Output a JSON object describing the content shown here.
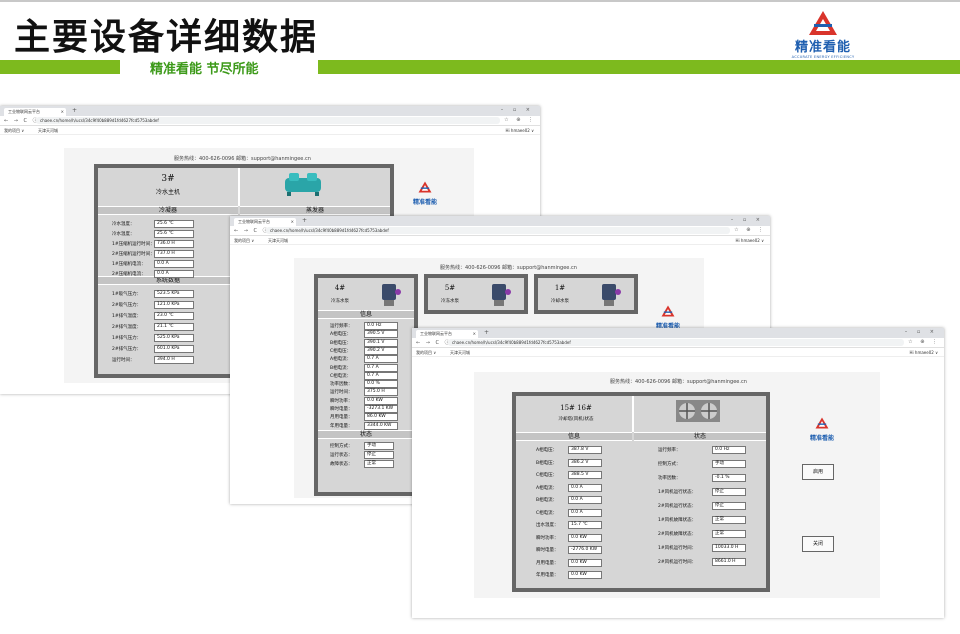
{
  "slide": {
    "title": "主要设备详细数据",
    "slogan": "精准看能 节尽所能",
    "brand_name": "精准看能",
    "brand_sub": "ACCURATE ENERGY EFFICIENCY",
    "colors": {
      "green": "#7dba1e",
      "brand_blue": "#1f5fb0",
      "brand_red": "#d9342b"
    }
  },
  "browser": {
    "tab_label": "工业物联网云平台",
    "url": "chaee.cn/home/h/ucsl/34c9f40b889d1fd4627fcd5753abdef",
    "bookmark_1": "我的项目 ∨",
    "bookmark_2": "天津天河城",
    "user": "Hi hmaee02 ∨",
    "hotline": "服务热线：400-626-0096 邮箱：support@hanmingee.cn"
  },
  "chiller": {
    "name": "3#",
    "type": "冷水主机",
    "sections": {
      "evap": "冷凝器",
      "cond": "蒸发器",
      "perf": "系统数据"
    },
    "fields": [
      {
        "label": "冷水温度：",
        "value": "25.6  ℃"
      },
      {
        "label": "冷水温度：",
        "value": "25.6  ℃"
      },
      {
        "label": "1#压缩机运行时间：",
        "value": "736.0  H"
      },
      {
        "label": "2#压缩机运行时间：",
        "value": "737.0  H"
      },
      {
        "label": "1#压缩机电流：",
        "value": "0.0    A"
      },
      {
        "label": "2#压缩机电流：",
        "value": "0.0    A"
      }
    ],
    "fields2": [
      {
        "label": "1#吸气压力：",
        "value": "523.5  KPa"
      },
      {
        "label": "2#吸气压力：",
        "value": "121.0  KPa"
      },
      {
        "label": "1#排气温度：",
        "value": "23.0   ℃"
      },
      {
        "label": "2#排气温度：",
        "value": "21.1   ℃"
      },
      {
        "label": "1#排气压力：",
        "value": "525.0  KPa"
      },
      {
        "label": "2#排气压力：",
        "value": "601.0  KPa"
      },
      {
        "label": "运行时间：",
        "value": "394.0  H"
      }
    ]
  },
  "pumps": {
    "p1": {
      "name": "4#",
      "type": "冷冻水泵"
    },
    "p2": {
      "name": "5#",
      "type": "冷冻水泵"
    },
    "p3": {
      "name": "1#",
      "type": "冷却水泵"
    },
    "section": "信息",
    "status_section": "状态",
    "fields": [
      {
        "label": "运行频率：",
        "value": "0.0    Hz"
      },
      {
        "label": "A相电压：",
        "value": "390.5  V"
      },
      {
        "label": "B相电压：",
        "value": "390.1  V"
      },
      {
        "label": "C相电压：",
        "value": "390.2  V"
      },
      {
        "label": "A相电流：",
        "value": "0.7    A"
      },
      {
        "label": "B相电流：",
        "value": "0.7    A"
      },
      {
        "label": "C相电流：",
        "value": "0.7    A"
      },
      {
        "label": "功率因数：",
        "value": "0.0    %"
      },
      {
        "label": "运行时间：",
        "value": "375.0  H"
      },
      {
        "label": "瞬时功率：",
        "value": "0.0    KW"
      },
      {
        "label": "瞬时电量：",
        "value": "-3273.1 KW"
      },
      {
        "label": "月用电量：",
        "value": "86.0   KW"
      },
      {
        "label": "年用电量：",
        "value": "3344.0 KW"
      }
    ],
    "status": [
      {
        "label": "控制方式：",
        "value": "手动"
      },
      {
        "label": "运行状态：",
        "value": "停止"
      },
      {
        "label": "故障状态：",
        "value": "正常"
      }
    ]
  },
  "tower": {
    "name": "15# 16#",
    "type": "冷却塔(风机)状态",
    "info": "信息",
    "state": "状态",
    "left_fields": [
      {
        "label": "A相电压：",
        "value": "387.8  V"
      },
      {
        "label": "B相电压：",
        "value": "386.2  V"
      },
      {
        "label": "C相电压：",
        "value": "388.5  V"
      },
      {
        "label": "A相电流：",
        "value": "0.0    A"
      },
      {
        "label": "B相电流：",
        "value": "0.0    A"
      },
      {
        "label": "C相电流：",
        "value": "0.0    A"
      },
      {
        "label": "出水温度：",
        "value": "15.7   ℃"
      },
      {
        "label": "瞬时功率：",
        "value": "0.0    KW"
      },
      {
        "label": "瞬时电量：",
        "value": "-2776.0 KW"
      },
      {
        "label": "月用电量：",
        "value": "0.0    KW"
      },
      {
        "label": "年用电量：",
        "value": "0.0    KW"
      }
    ],
    "right_fields": [
      {
        "label": "运行频率：",
        "value": "0.0    Hz"
      },
      {
        "label": "控制方式：",
        "value": "手动"
      },
      {
        "label": "功率因数：",
        "value": "-0.1   %"
      },
      {
        "label": "1#风机运行状态：",
        "value": "停止"
      },
      {
        "label": "2#风机运行状态：",
        "value": "停止"
      },
      {
        "label": "1#风机故障状态：",
        "value": "正常"
      },
      {
        "label": "2#风机故障状态：",
        "value": "正常"
      },
      {
        "label": "1#风机运行时间：",
        "value": "10033.0 H"
      },
      {
        "label": "2#风机运行时间：",
        "value": "8661.0  H"
      }
    ],
    "btn_on": "启用",
    "btn_off": "关闭"
  }
}
